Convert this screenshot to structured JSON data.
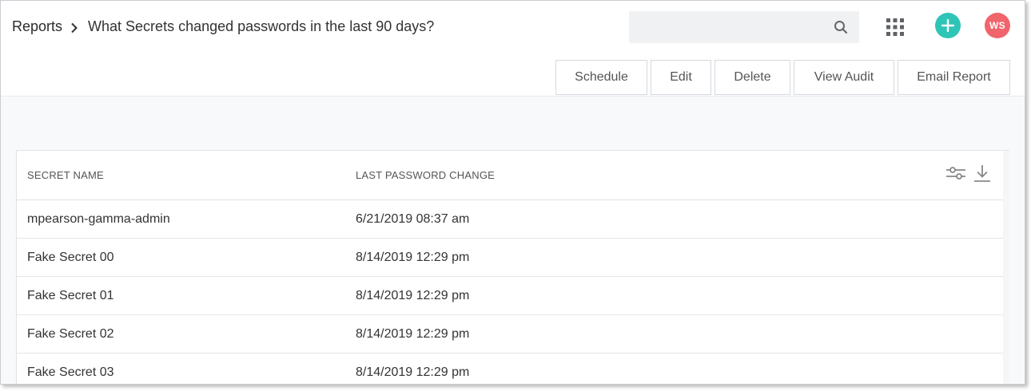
{
  "breadcrumb": {
    "root": "Reports",
    "separator_icon": "chevron-right-icon",
    "current": "What Secrets changed passwords in the last 90 days?"
  },
  "search": {
    "value": "",
    "placeholder": "",
    "icon": "search-icon"
  },
  "header_icons": {
    "apps": "apps-grid-icon",
    "add": "plus-icon"
  },
  "user": {
    "initials": "WS"
  },
  "toolbar": {
    "schedule": "Schedule",
    "edit": "Edit",
    "delete": "Delete",
    "view_audit": "View Audit",
    "email_report": "Email Report"
  },
  "table": {
    "columns": [
      "SECRET NAME",
      "LAST PASSWORD CHANGE"
    ],
    "actions": [
      "filter-sliders-icon",
      "download-icon"
    ],
    "rows": [
      {
        "name": "mpearson-gamma-admin",
        "date": "6/21/2019 08:37 am"
      },
      {
        "name": "Fake Secret 00",
        "date": "8/14/2019 12:29 pm"
      },
      {
        "name": "Fake Secret 01",
        "date": "8/14/2019 12:29 pm"
      },
      {
        "name": "Fake Secret 02",
        "date": "8/14/2019 12:29 pm"
      },
      {
        "name": "Fake Secret 03",
        "date": "8/14/2019 12:29 pm"
      }
    ]
  },
  "colors": {
    "accent_add": "#2ec4b6",
    "avatar_bg": "#f0646b",
    "page_bg": "#f8f9fa",
    "border": "#dfe3e6"
  }
}
